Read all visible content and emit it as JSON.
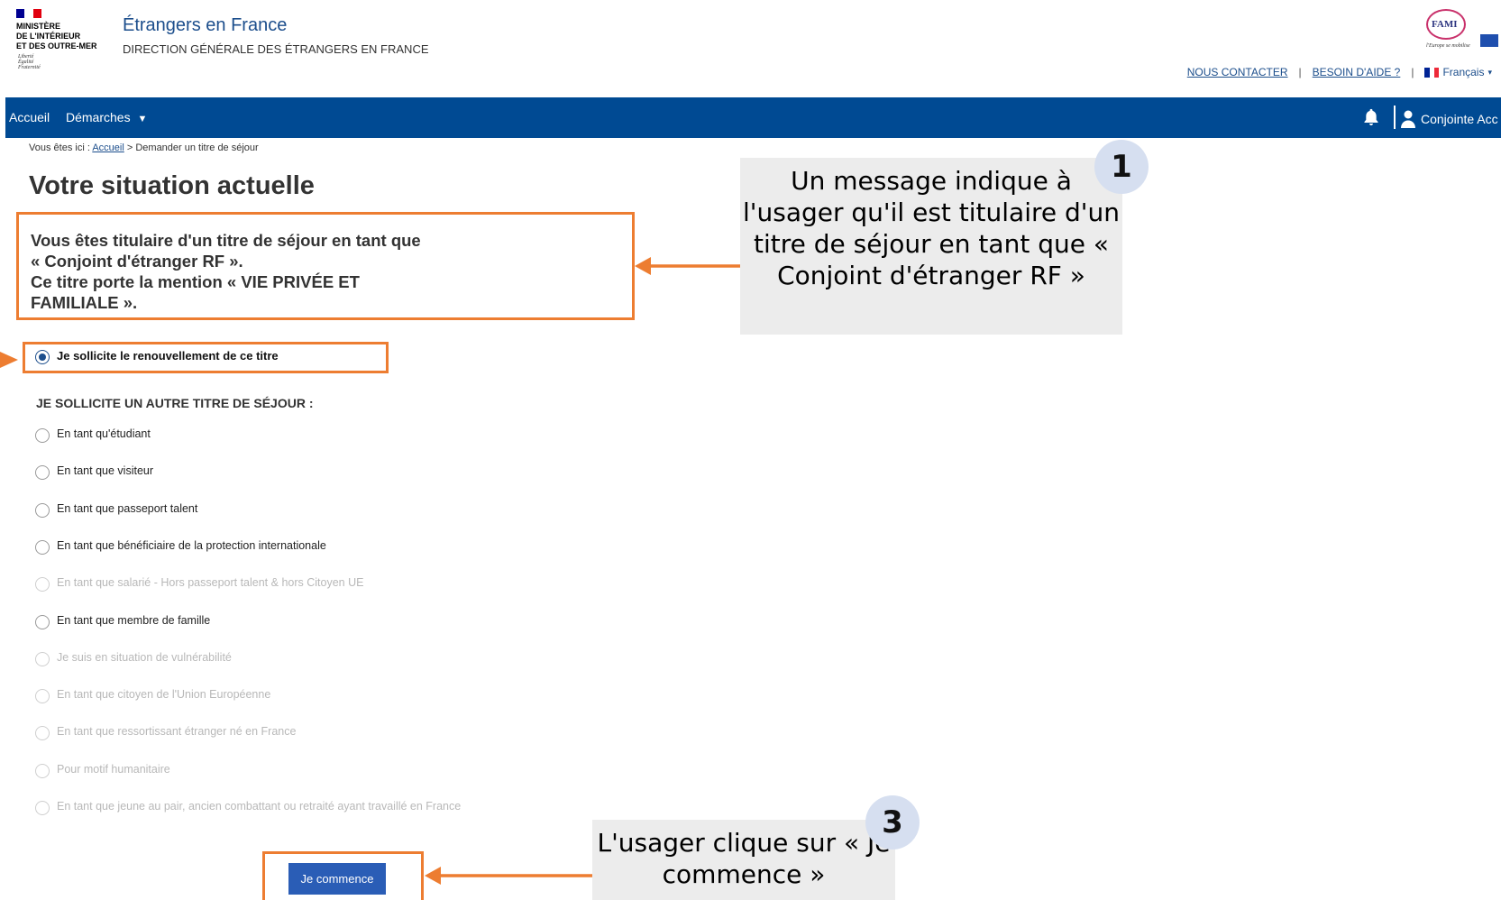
{
  "header": {
    "ministry_text": "MINISTÈRE\nDE L'INTÉRIEUR\nET DES OUTRE-MER",
    "devise": "Liberté\nÉgalité\nFraternité",
    "site_title": "Étrangers en France",
    "site_subtitle": "DIRECTION GÉNÉRALE DES ÉTRANGERS EN FRANCE",
    "fami_logo_text": "FAMI",
    "fami_tagline": "l'Europe se mobilise",
    "links": {
      "contact": "NOUS CONTACTER",
      "help": "BESOIN D'AIDE ?",
      "separator": "|",
      "language": "Français"
    }
  },
  "nav": {
    "home": "Accueil",
    "demarches": "Démarches",
    "user": "Conjointe Acc"
  },
  "breadcrumb": {
    "prefix": "Vous êtes ici :",
    "home_link": "Accueil",
    "current": "> Demander un titre de séjour"
  },
  "page_title": "Votre situation actuelle",
  "message": {
    "line1": "Vous êtes titulaire d'un titre de séjour en tant que",
    "line2": "« Conjoint d'étranger RF ».",
    "line3": "Ce titre porte la mention « VIE PRIVÉE ET",
    "line4": "FAMILIALE »."
  },
  "renewal_option": "Je sollicite le renouvellement de ce titre",
  "other_section_title": "JE SOLLICITE UN AUTRE TITRE DE SÉJOUR :",
  "options": [
    {
      "label": "En tant qu'étudiant",
      "enabled": true
    },
    {
      "label": "En tant que visiteur",
      "enabled": true
    },
    {
      "label": "En tant que passeport talent",
      "enabled": true
    },
    {
      "label": "En tant que bénéficiaire de la protection internationale",
      "enabled": true
    },
    {
      "label": "En tant que salarié - Hors passeport talent & hors Citoyen UE",
      "enabled": false
    },
    {
      "label": "En tant que membre de famille",
      "enabled": true
    },
    {
      "label": "Je suis en situation de vulnérabilité",
      "enabled": false
    },
    {
      "label": "En tant que citoyen de l'Union Européenne",
      "enabled": false
    },
    {
      "label": "En tant que ressortissant étranger né en France",
      "enabled": false
    },
    {
      "label": "Pour motif humanitaire",
      "enabled": false
    },
    {
      "label": "En tant que jeune au pair, ancien combattant ou retraité ayant travaillé en France",
      "enabled": false
    }
  ],
  "start_button": "Je commence",
  "callouts": {
    "one": {
      "number": "1",
      "text": "Un message indique à l'usager qu'il est titulaire d'un titre de séjour en tant que « Conjoint d'étranger RF »"
    },
    "three": {
      "number": "3",
      "text": "L'usager clique sur « Je commence »"
    }
  },
  "colors": {
    "nav_bg": "#004a93",
    "link": "#1c4e8c",
    "highlight": "#ed7d31",
    "button": "#2a5db6",
    "callout_bg": "#ececec",
    "badge_bg": "#d6dff0"
  }
}
